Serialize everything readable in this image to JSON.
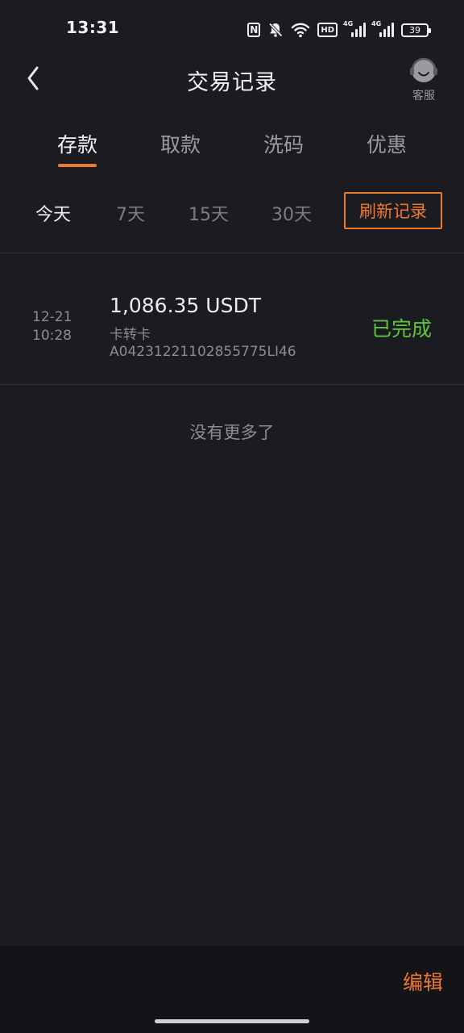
{
  "status_bar": {
    "time": "13:31",
    "nfc_label": "N",
    "hd_label": "HD",
    "network_1": "4G",
    "network_2": "4G",
    "battery": "39"
  },
  "header": {
    "title": "交易记录",
    "support_label": "客服"
  },
  "tabs": [
    {
      "label": "存款"
    },
    {
      "label": "取款"
    },
    {
      "label": "洗码"
    },
    {
      "label": "优惠"
    }
  ],
  "filters": [
    {
      "label": "今天"
    },
    {
      "label": "7天"
    },
    {
      "label": "15天"
    },
    {
      "label": "30天"
    }
  ],
  "refresh_label": "刷新记录",
  "records": [
    {
      "date": "12-21",
      "time": "10:28",
      "amount": "1,086.35 USDT",
      "type": "卡转卡",
      "id": "A04231221102855775LI46",
      "status": "已完成"
    }
  ],
  "no_more": "没有更多了",
  "edit_label": "编辑",
  "colors": {
    "background": "#1b1c22",
    "accent": "#f0782d",
    "success": "#5fc53b"
  }
}
